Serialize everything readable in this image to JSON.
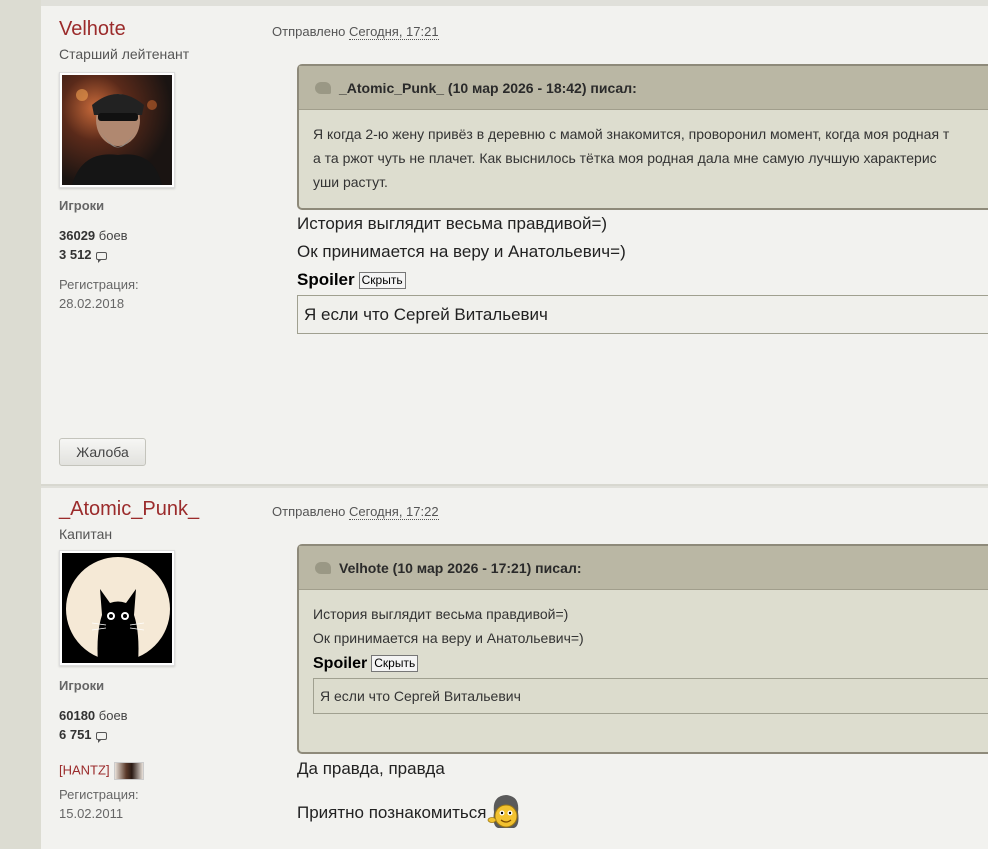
{
  "posts": [
    {
      "author": "Velhote",
      "rank": "Старший лейтенант",
      "group": "Игроки",
      "battles_count": "36029",
      "battles_label": " боев",
      "posts_count": "3 512",
      "reg_label": "Регистрация:",
      "reg_date": "28.02.2018",
      "posted_label": "Отправлено ",
      "posted_date": "Сегодня, 17:21",
      "quote_header": "_Atomic_Punk_ (10 мар 2026 - 18:42) писал:",
      "quote_lines": [
        "Я когда 2-ю жену привёз в деревню с мамой знакомится, проворонил момент, когда моя родная т",
        "а та ржот чуть не плачет. Как выснилось тётка моя родная дала мне самую лучшую характерис",
        "уши растут."
      ],
      "lines": [
        "История выглядит весьма правдивой=)",
        "Ок принимается на веру и Анатольевич=)"
      ],
      "spoiler_label": "Spoiler",
      "spoiler_button": "Скрыть",
      "spoiler_text": "Я если что Сергей Витальевич",
      "complaint_button": "Жалоба"
    },
    {
      "author": "_Atomic_Punk_",
      "rank": "Капитан",
      "group": "Игроки",
      "battles_count": "60180",
      "battles_label": " боев",
      "posts_count": "6 751",
      "clan": "[HANTZ]",
      "reg_label": "Регистрация:",
      "reg_date": "15.02.2011",
      "posted_label": "Отправлено ",
      "posted_date": "Сегодня, 17:22",
      "quote_header": "Velhote (10 мар 2026 - 17:21) писал:",
      "quote_lines": [
        "История выглядит весьма правдивой=)",
        "Ок принимается на веру и Анатольевич=)"
      ],
      "quote_spoiler_label": "Spoiler",
      "quote_spoiler_button": "Скрыть",
      "quote_spoiler_text": "Я если что Сергей Витальевич",
      "lines": [
        "Да правда, правда",
        "Приятно познакомиться"
      ]
    }
  ]
}
